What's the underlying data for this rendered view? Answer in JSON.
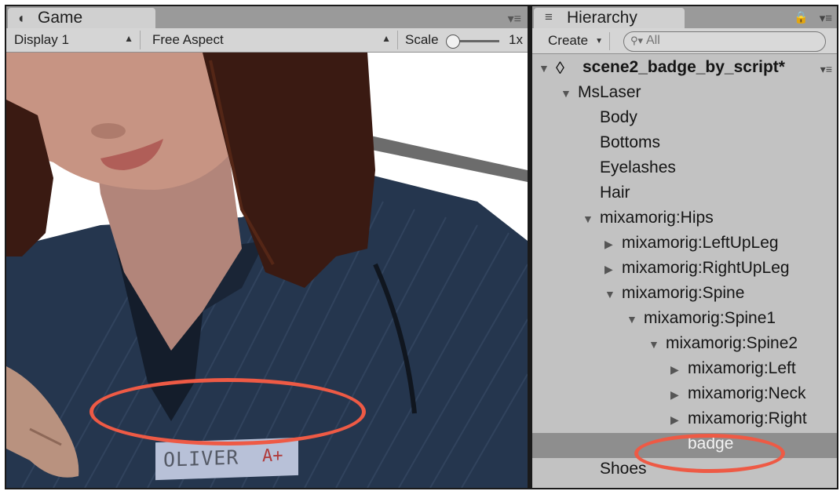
{
  "game": {
    "tab_icon": "pacman-icon",
    "tab_title": "Game",
    "display": "Display 1",
    "aspect": "Free Aspect",
    "scale_label": "Scale",
    "scale_value": "1x",
    "badge_name": "OLIVER",
    "badge_grade": "A+"
  },
  "hierarchy": {
    "tab_title": "Hierarchy",
    "create_label": "Create",
    "search_placeholder": "All",
    "scene_name": "scene2_badge_by_script*",
    "items": [
      {
        "label": "MsLaser",
        "arrow": "expanded"
      },
      {
        "label": "Body",
        "arrow": "none"
      },
      {
        "label": "Bottoms",
        "arrow": "none"
      },
      {
        "label": "Eyelashes",
        "arrow": "none"
      },
      {
        "label": "Hair",
        "arrow": "none"
      },
      {
        "label": "mixamorig:Hips",
        "arrow": "expanded"
      },
      {
        "label": "mixamorig:LeftUpLeg",
        "arrow": "collapsed"
      },
      {
        "label": "mixamorig:RightUpLeg",
        "arrow": "collapsed"
      },
      {
        "label": "mixamorig:Spine",
        "arrow": "expanded"
      },
      {
        "label": "mixamorig:Spine1",
        "arrow": "expanded"
      },
      {
        "label": "mixamorig:Spine2",
        "arrow": "expanded"
      },
      {
        "label": "mixamorig:Left",
        "arrow": "collapsed"
      },
      {
        "label": "mixamorig:Neck",
        "arrow": "collapsed"
      },
      {
        "label": "mixamorig:Right",
        "arrow": "collapsed"
      },
      {
        "label": "badge",
        "arrow": "none",
        "selected": true
      },
      {
        "label": "Shoes",
        "arrow": "none"
      }
    ]
  },
  "colors": {
    "highlight_ring": "#ee5a45",
    "selected_row": "#8e8e8e",
    "panel_bg": "#c2c2c2"
  }
}
